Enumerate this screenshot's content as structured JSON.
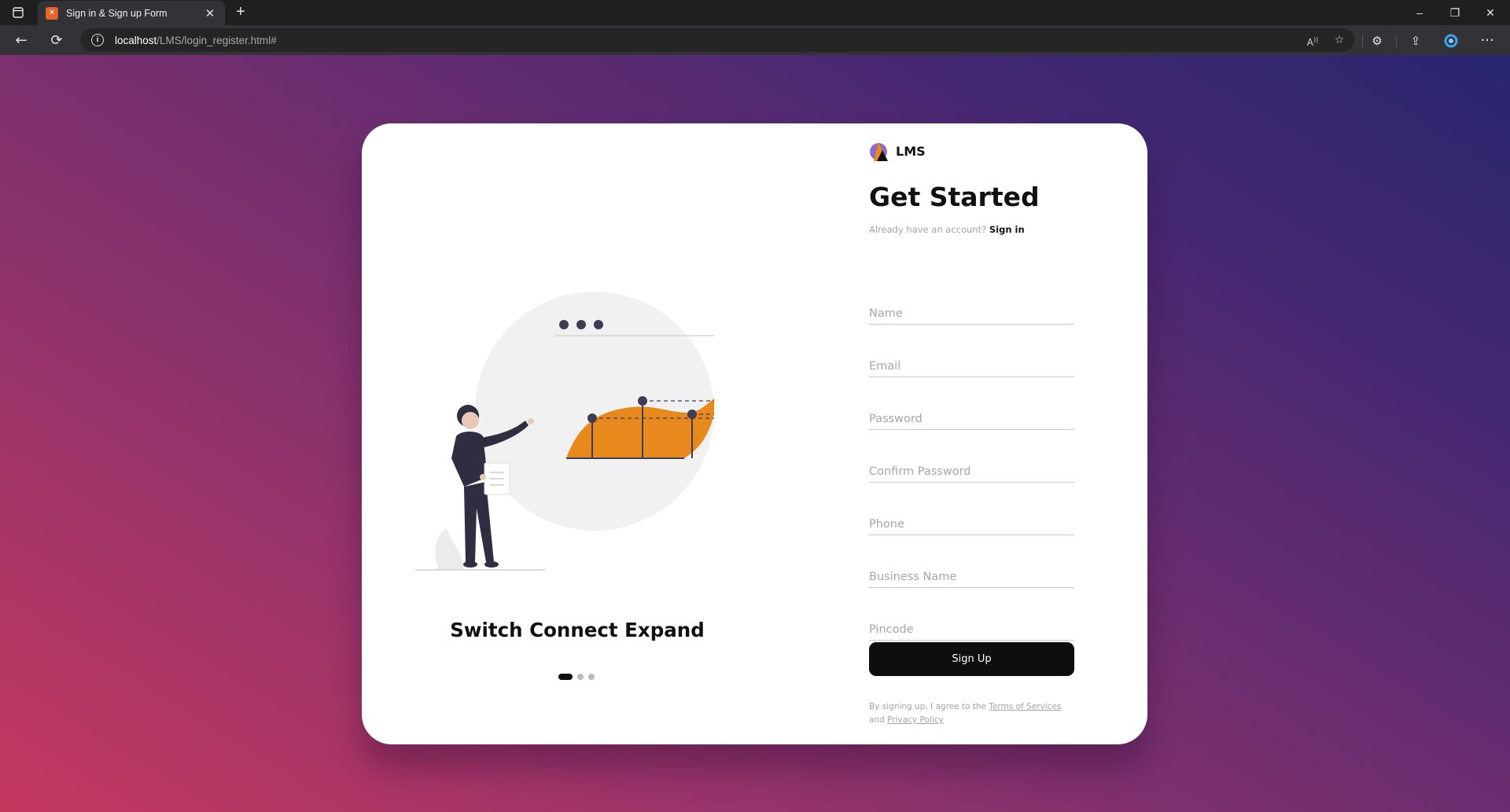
{
  "browser": {
    "tab_title": "Sign in & Sign up Form",
    "url_host": "localhost",
    "url_rest": "/LMS/login_register.html#"
  },
  "page": {
    "brand": "LMS",
    "heading": "Get Started",
    "have_account_text": "Already have an account?",
    "signin_link": "Sign in",
    "fields": {
      "name": "Name",
      "email": "Email",
      "password": "Password",
      "confirm_password": "Confirm Password",
      "phone": "Phone",
      "business_name": "Business Name",
      "pincode": "Pincode"
    },
    "signup_button": "Sign Up",
    "terms_text": "By signing up, I agree to the",
    "terms_link": "Terms of Services",
    "and_text": "and",
    "privacy_link": "Privacy Policy",
    "slogan": "Switch Connect Expand",
    "carousel": {
      "total": 3,
      "active": 1
    }
  },
  "colors": {
    "accent_orange": "#e8891d",
    "button_dark": "#0e0e0e",
    "gradient_start": "#c4385f",
    "gradient_end": "#28266e"
  }
}
